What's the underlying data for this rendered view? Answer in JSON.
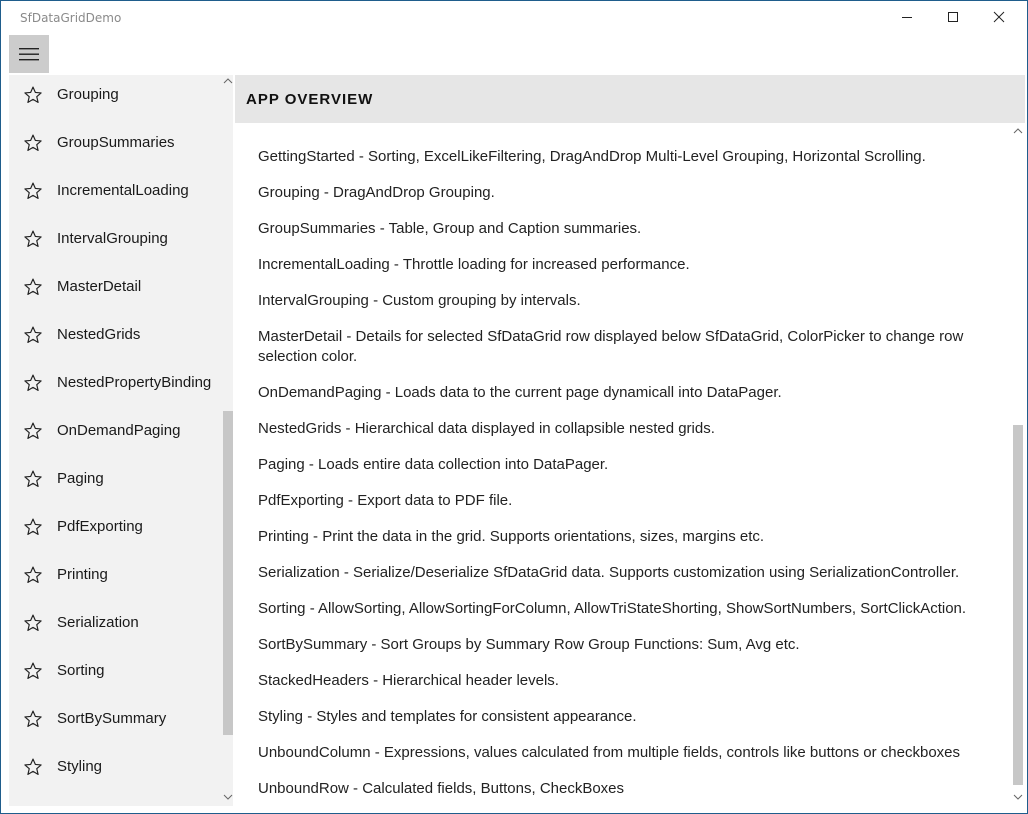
{
  "window": {
    "title": "SfDataGridDemo"
  },
  "icons": {
    "menu": "hamburger-menu-icon",
    "favorite": "star-outline-icon",
    "minimize": "minimize-icon",
    "maximize": "maximize-icon",
    "close": "close-icon"
  },
  "sidebar": {
    "items": [
      {
        "label": "Grouping"
      },
      {
        "label": "GroupSummaries"
      },
      {
        "label": "IncrementalLoading"
      },
      {
        "label": "IntervalGrouping"
      },
      {
        "label": "MasterDetail"
      },
      {
        "label": "NestedGrids"
      },
      {
        "label": "NestedPropertyBinding"
      },
      {
        "label": "OnDemandPaging"
      },
      {
        "label": "Paging"
      },
      {
        "label": "PdfExporting"
      },
      {
        "label": "Printing"
      },
      {
        "label": "Serialization"
      },
      {
        "label": "Sorting"
      },
      {
        "label": "SortBySummary"
      },
      {
        "label": "Styling"
      }
    ]
  },
  "overview": {
    "header": "APP OVERVIEW",
    "entries": [
      {
        "text": "GettingStarted - Sorting, ExcelLikeFiltering, DragAndDrop Multi-Level Grouping, Horizontal Scrolling."
      },
      {
        "text": "Grouping - DragAndDrop Grouping."
      },
      {
        "text": "GroupSummaries - Table, Group and Caption summaries."
      },
      {
        "text": "IncrementalLoading - Throttle loading for increased performance."
      },
      {
        "text": "IntervalGrouping - Custom grouping by intervals."
      },
      {
        "text": "MasterDetail - Details for selected SfDataGrid row displayed below SfDataGrid, ColorPicker to change row selection color."
      },
      {
        "text": "OnDemandPaging - Loads data to the current page dynamicall into DataPager."
      },
      {
        "text": "NestedGrids - Hierarchical data displayed in collapsible nested grids."
      },
      {
        "text": "Paging - Loads entire data collection into DataPager."
      },
      {
        "text": "PdfExporting - Export data to PDF file."
      },
      {
        "text": "Printing - Print the data in the grid. Supports orientations, sizes, margins etc."
      },
      {
        "text": "Serialization - Serialize/Deserialize SfDataGrid data. Supports customization using SerializationController."
      },
      {
        "text": "Sorting - AllowSorting, AllowSortingForColumn, AllowTriStateShorting, ShowSortNumbers, SortClickAction."
      },
      {
        "text": "SortBySummary - Sort Groups by Summary Row Group Functions: Sum, Avg etc."
      },
      {
        "text": "StackedHeaders - Hierarchical header levels."
      },
      {
        "text": "Styling - Styles and templates for consistent appearance."
      },
      {
        "text": "UnboundColumn - Expressions, values calculated from multiple fields, controls like buttons or checkboxes"
      },
      {
        "text": "UnboundRow - Calculated fields, Buttons, CheckBoxes"
      }
    ]
  }
}
